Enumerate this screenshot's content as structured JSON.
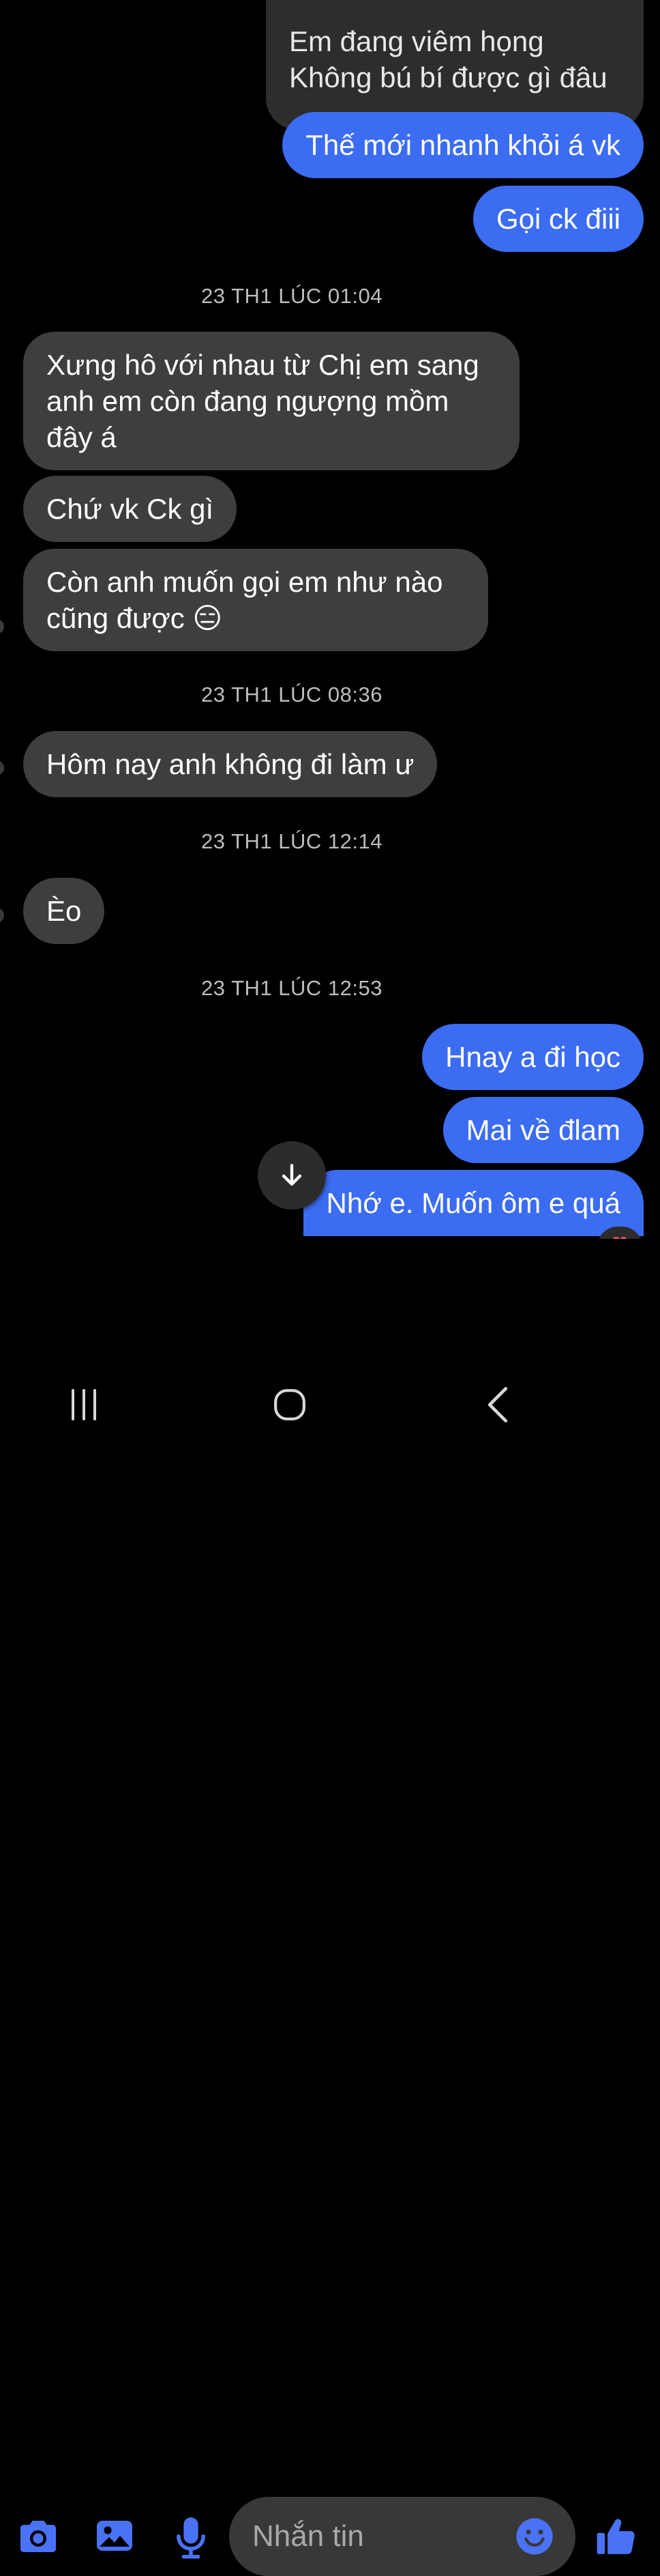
{
  "messages": [
    {
      "side": "out-dark",
      "text": "Em đang viêm họng\nKhông bú bí được gì đâu"
    },
    {
      "side": "out",
      "text": "Thế mới nhanh khỏi á vk"
    },
    {
      "side": "out",
      "text": "Gọi ck điii"
    },
    {
      "timestamp": "23 TH1 LÚC 01:04"
    },
    {
      "side": "in",
      "text": "Xưng hô với nhau từ Chị em sang\nanh em còn đang ngượng mồm\nđây á"
    },
    {
      "side": "in",
      "text": "Chứ vk Ck gì"
    },
    {
      "side": "in",
      "text": "Còn anh muốn gọi em như nào\ncũng được 😑"
    },
    {
      "timestamp": "23 TH1 LÚC 08:36"
    },
    {
      "side": "in",
      "text": "Hôm nay anh không đi làm ư"
    },
    {
      "timestamp": "23 TH1 LÚC 12:14"
    },
    {
      "side": "in",
      "text": "Èo"
    },
    {
      "timestamp": "23 TH1 LÚC 12:53"
    },
    {
      "side": "out",
      "text": "Hnay a đi học"
    },
    {
      "side": "out",
      "text": "Mai về đlam"
    },
    {
      "side": "out",
      "text": "Nhớ e. Muốn ôm e quá"
    }
  ],
  "composer": {
    "placeholder": "Nhắn tin",
    "icons": [
      "camera-icon",
      "image-icon",
      "microphone-icon",
      "emoji-icon",
      "thumbs-up-icon"
    ]
  },
  "navbar": {
    "icons": [
      "recent-apps-icon",
      "home-icon",
      "back-icon"
    ]
  },
  "colors": {
    "background": "#000000",
    "outgoing_bubble": "#3b6cf2",
    "incoming_bubble": "#3e3e3e",
    "accent_icons": "#4a72f5",
    "timestamp_text": "#bdbdbd"
  },
  "scroll_button": {
    "icon": "arrow-down-icon"
  },
  "reaction": {
    "icon": "heart-icon"
  }
}
